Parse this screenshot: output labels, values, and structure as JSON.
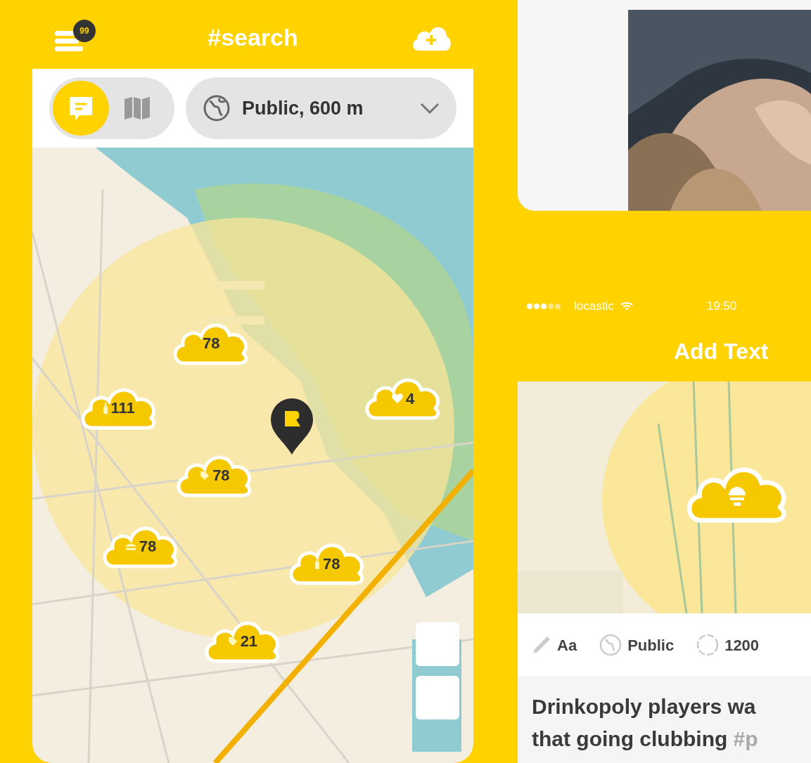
{
  "search_screen": {
    "notifications_badge": "99",
    "title": "#search",
    "view_toggle": [
      {
        "kind": "list",
        "selected": true
      },
      {
        "kind": "map",
        "selected": false
      }
    ],
    "filter": {
      "label": "Public, 600 m"
    },
    "markers": [
      {
        "count": "78",
        "kind": "plain"
      },
      {
        "count": "111",
        "kind": "drink"
      },
      {
        "count": "4",
        "kind": "heart"
      },
      {
        "count": "78",
        "kind": "tag"
      },
      {
        "count": "78",
        "kind": "food"
      },
      {
        "count": "78",
        "kind": "drink"
      },
      {
        "count": "21",
        "kind": "tag"
      }
    ]
  },
  "add_text_screen": {
    "status_bar": {
      "carrier": "locastic",
      "time": "19:50"
    },
    "title": "Add Text",
    "toolbar": [
      {
        "kind": "font",
        "label": "Aa"
      },
      {
        "kind": "visibility",
        "label": "Public"
      },
      {
        "kind": "radius",
        "label": "1200"
      }
    ],
    "post_lines": [
      {
        "text": "Drinkopoly players wa"
      },
      {
        "text": "that going clubbing",
        "tag": "#p"
      }
    ]
  }
}
